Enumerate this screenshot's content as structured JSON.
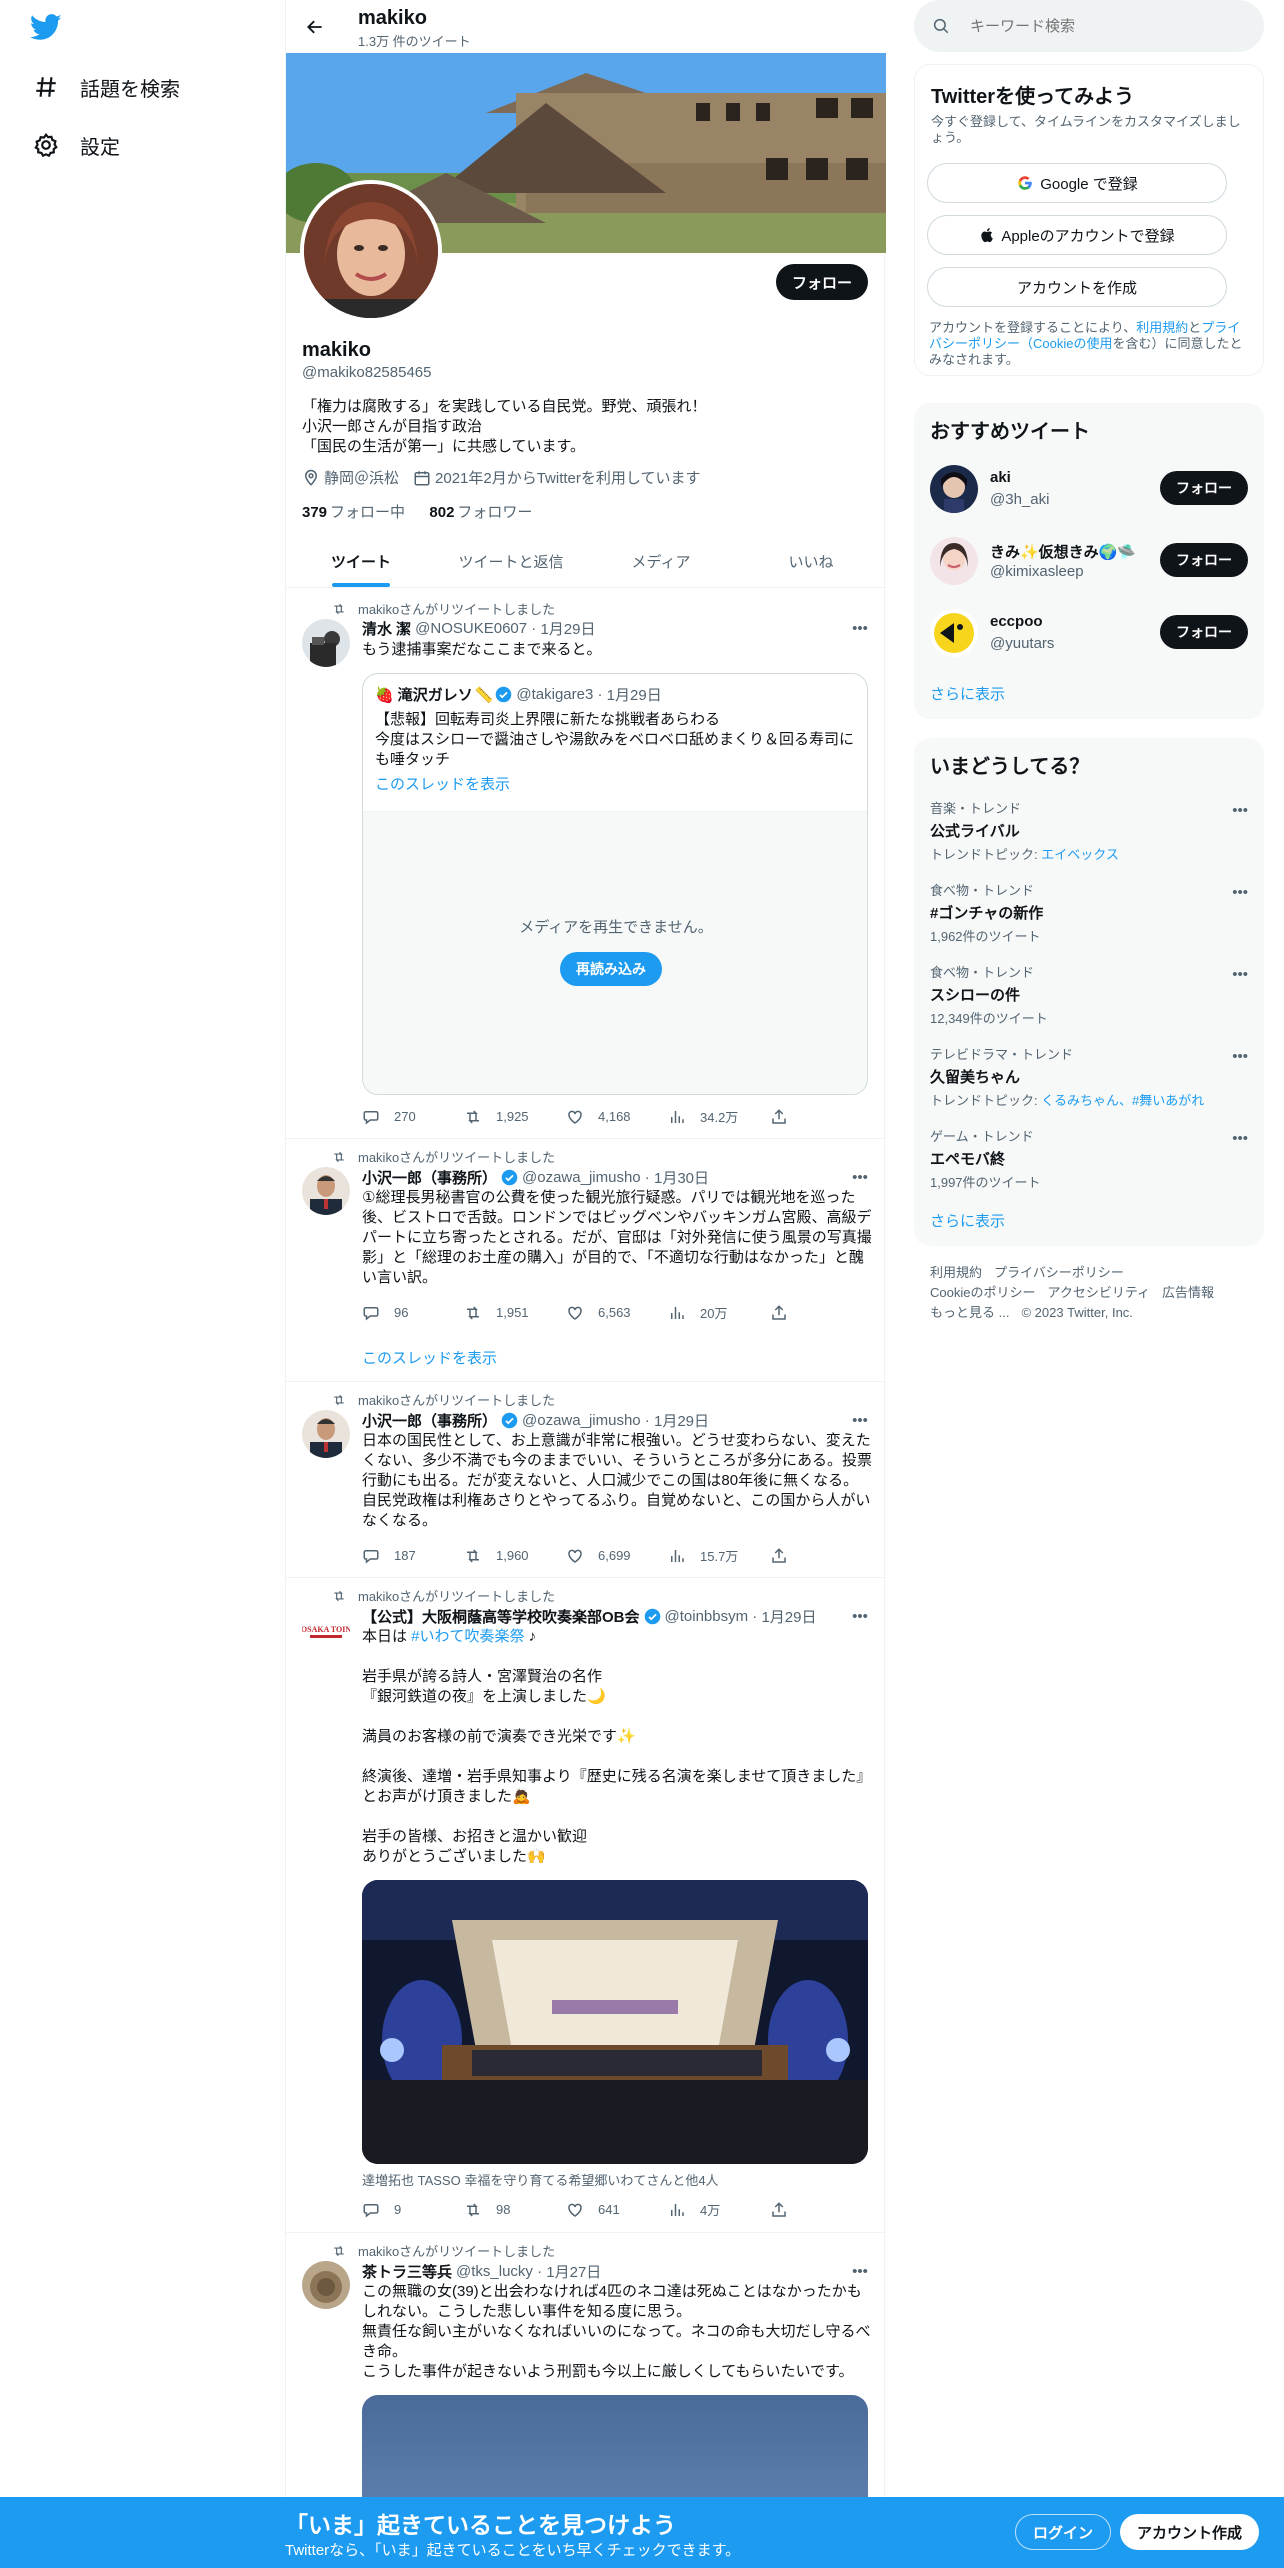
{
  "nav": {
    "explore_label": "話題を検索",
    "settings_label": "設定"
  },
  "header": {
    "name": "makiko",
    "tweet_count": "1.3万 件のツイート"
  },
  "profile": {
    "name": "makiko",
    "handle": "@makiko82585465",
    "follow_label": "フォロー",
    "bio": "「権力は腐敗する」を実践している自民党。野党、頑張れ！\n小沢一郎さんが目指す政治\n「国民の生活が第一」に共感しています。",
    "location": "静岡＠浜松",
    "joined": "2021年2月からTwitterを利用しています",
    "following_count": "379",
    "following_label": "フォロー中",
    "followers_count": "802",
    "followers_label": "フォロワー"
  },
  "tabs": [
    "ツイート",
    "ツイートと返信",
    "メディア",
    "いいね"
  ],
  "tweets": [
    {
      "retweeted_by": "makikoさんがリツイートしました",
      "name": "清水 潔",
      "handle": "@NOSUKE0607",
      "date": "1月29日",
      "text": "もう逮捕事案だなここまで来ると。",
      "quote": {
        "name": "滝沢ガレソ",
        "handle": "@takigare3",
        "date": "1月29日",
        "text": "【悲報】回転寿司炎上界隈に新たな挑戦者あらわる\n今度はスシローで醤油さしや湯飲みをベロベロ舐めまくり＆回る寿司にも唾タッチ",
        "thread_label": "このスレッドを表示",
        "media_error": "メディアを再生できません。",
        "reload_label": "再読み込み"
      },
      "replies": "270",
      "retweets": "1,925",
      "likes": "4,168",
      "views": "34.2万"
    },
    {
      "retweeted_by": "makikoさんがリツイートしました",
      "name": "小沢一郎（事務所）",
      "handle": "@ozawa_jimusho",
      "date": "1月30日",
      "text": "①総理長男秘書官の公費を使った観光旅行疑惑。パリでは観光地を巡った後、ビストロで舌鼓。ロンドンではビッグベンやバッキンガム宮殿、高級デパートに立ち寄ったとされる。だが、官邸は「対外発信に使う風景の写真撮影」と「総理のお土産の購入」が目的で、「不適切な行動はなかった」と醜い言い訳。",
      "replies": "96",
      "retweets": "1,951",
      "likes": "6,563",
      "views": "20万",
      "thread_label": "このスレッドを表示"
    },
    {
      "retweeted_by": "makikoさんがリツイートしました",
      "name": "小沢一郎（事務所）",
      "handle": "@ozawa_jimusho",
      "date": "1月29日",
      "text": "日本の国民性として、お上意識が非常に根強い。どうせ変わらない、変えたくない、多少不満でも今のままでいい、そういうところが多分にある。投票行動にも出る。だが変えないと、人口減少でこの国は80年後に無くなる。自民党政権は利権あさりとやってるふり。自覚めないと、この国から人がいなくなる。",
      "replies": "187",
      "retweets": "1,960",
      "likes": "6,699",
      "views": "15.7万"
    },
    {
      "retweeted_by": "makikoさんがリツイートしました",
      "name": "【公式】大阪桐蔭高等学校吹奏楽部OB会",
      "handle": "@toinbbsym",
      "date": "1月29日",
      "text_before": "本日は ",
      "hashtag": "#いわて吹奏楽祭",
      "text_after": " ♪\n\n岩手県が誇る詩人・宮澤賢治の名作\n『銀河鉄道の夜』を上演しました🌙\n\n満員のお客様の前で演奏でき光栄です✨\n\n終演後、達増・岩手県知事より『歴史に残る名演を楽しませて頂きました』とお声がけ頂きました🙇\n\n岩手の皆様、お招きと温かい歓迎\nありがとうございました🙌",
      "tagged": "達増拓也 TASSO 幸福を守り育てる希望郷いわてさんと他4人",
      "replies": "9",
      "retweets": "98",
      "likes": "641",
      "views": "4万"
    },
    {
      "retweeted_by": "makikoさんがリツイートしました",
      "name": "茶トラ三等兵",
      "handle": "@tks_lucky",
      "date": "1月27日",
      "text": "この無職の女(39)と出会わなければ4匹のネコ達は死ぬことはなかったかもしれない。こうした悲しい事件を知る度に思う。\n無責任な飼い主がいなくなればいいのになって。ネコの命も大切だし守るべき命。\nこうした事件が起きないよう刑罰も今以上に厳しくしてもらいたいです。"
    }
  ],
  "search": {
    "placeholder": "キーワード検索"
  },
  "signup_box": {
    "title": "Twitterを使ってみよう",
    "subtitle": "今すぐ登録して、タイムラインをカスタマイズしましょう。",
    "google_label": "Google で登録",
    "apple_label": "Appleのアカウントで登録",
    "create_label": "アカウントを作成",
    "terms_before": "アカウントを登録することにより、",
    "terms_link1": "利用規約",
    "terms_mid": "と",
    "terms_link2": "プライバシーポリシー（Cookieの使用",
    "terms_after": "を含む）に同意したとみなされます。"
  },
  "recommended": {
    "title": "おすすめツイート",
    "items": [
      {
        "name": "aki",
        "handle": "@3h_aki",
        "follow_label": "フォロー"
      },
      {
        "name": "きみ✨仮想きみ🌍🛸",
        "handle": "@kimixasleep",
        "follow_label": "フォロー"
      },
      {
        "name": "eccpoo",
        "handle": "@yuutars",
        "follow_label": "フォロー"
      }
    ],
    "more_label": "さらに表示"
  },
  "trends": {
    "title": "いまどうしてる？",
    "items": [
      {
        "category": "音楽・トレンド",
        "topic": "公式ライバル",
        "sub_before": "トレンドトピック: ",
        "sub_link": "エイベックス"
      },
      {
        "category": "食べ物・トレンド",
        "topic": "#ゴンチャの新作",
        "sub_before": "1,962件のツイート",
        "sub_link": ""
      },
      {
        "category": "食べ物・トレンド",
        "topic": "スシローの件",
        "sub_before": "12,349件のツイート",
        "sub_link": ""
      },
      {
        "category": "テレビドラマ・トレンド",
        "topic": "久留美ちゃん",
        "sub_before": "トレンドトピック: ",
        "sub_link": "くるみちゃん、#舞いあがれ"
      },
      {
        "category": "ゲーム・トレンド",
        "topic": "エペモバ終",
        "sub_before": "1,997件のツイート",
        "sub_link": ""
      }
    ],
    "more_label": "さらに表示"
  },
  "footer": {
    "links": [
      "利用規約",
      "プライバシーポリシー",
      "Cookieのポリシー",
      "アクセシビリティ",
      "広告情報",
      "もっと見る ..."
    ],
    "copyright": "© 2023 Twitter, Inc."
  },
  "bottom_bar": {
    "title": "「いま」起きていることを見つけよう",
    "subtitle": "Twitterなら、「いま」起きていることをいち早くチェックできます。",
    "login_label": "ログイン",
    "signup_label": "アカウント作成"
  },
  "colors": {
    "accent": "#1d9bf0",
    "text": "#0f1419",
    "muted": "#536471"
  }
}
